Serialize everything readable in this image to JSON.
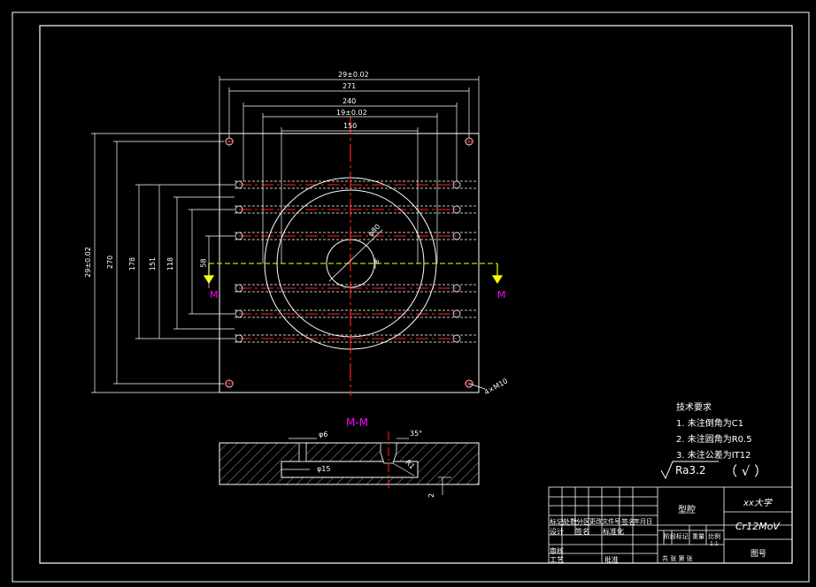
{
  "colors": {
    "background": "#000000",
    "frame": "#ffffff",
    "centerline": "#ff2020",
    "hidden_line": "#ffffff",
    "section_line": "#ffff00",
    "section_label": "#ff00ff"
  },
  "plan_view": {
    "dims_top": [
      "29±0.02",
      "271",
      "240",
      "19±0.02",
      "150"
    ],
    "dims_left": [
      "29±0.02",
      "270",
      "178",
      "151",
      "118",
      "58"
    ],
    "hole_callout": "4×M10",
    "center_hole_diameter": "φ80",
    "center_offset": "8",
    "section_markers": [
      "M",
      "M"
    ]
  },
  "section_view": {
    "title": "M-M",
    "dim_groove_top": "φ6",
    "dim_groove_bottom": "φ15",
    "dim_angle": "35°",
    "dim_r": "R1",
    "dim_depth": "2"
  },
  "notes": {
    "title": "技术要求",
    "items": [
      "1. 未注倒角为C1",
      "2. 未注圆角为R0.5",
      "3. 未注公差为IT12"
    ],
    "roughness": "Ra3.2",
    "roughness_mark": "（ √ ）"
  },
  "title_block": {
    "part_name": "型腔",
    "school": "xx大学",
    "material": "Cr12MoV",
    "drawing_no_label": "图号",
    "row_labels_1": [
      "标记",
      "处数",
      "分区",
      "更改文件号",
      "签名",
      "年月日"
    ],
    "row_labels_2": [
      "设计",
      "签名",
      "标准化"
    ],
    "row_labels_3": [
      "审核",
      "工艺",
      "批准"
    ],
    "stage_labels": [
      "阶段标记",
      "重量",
      "比例"
    ],
    "scale": "1:1",
    "sheet_text": "共  张  第  张"
  }
}
